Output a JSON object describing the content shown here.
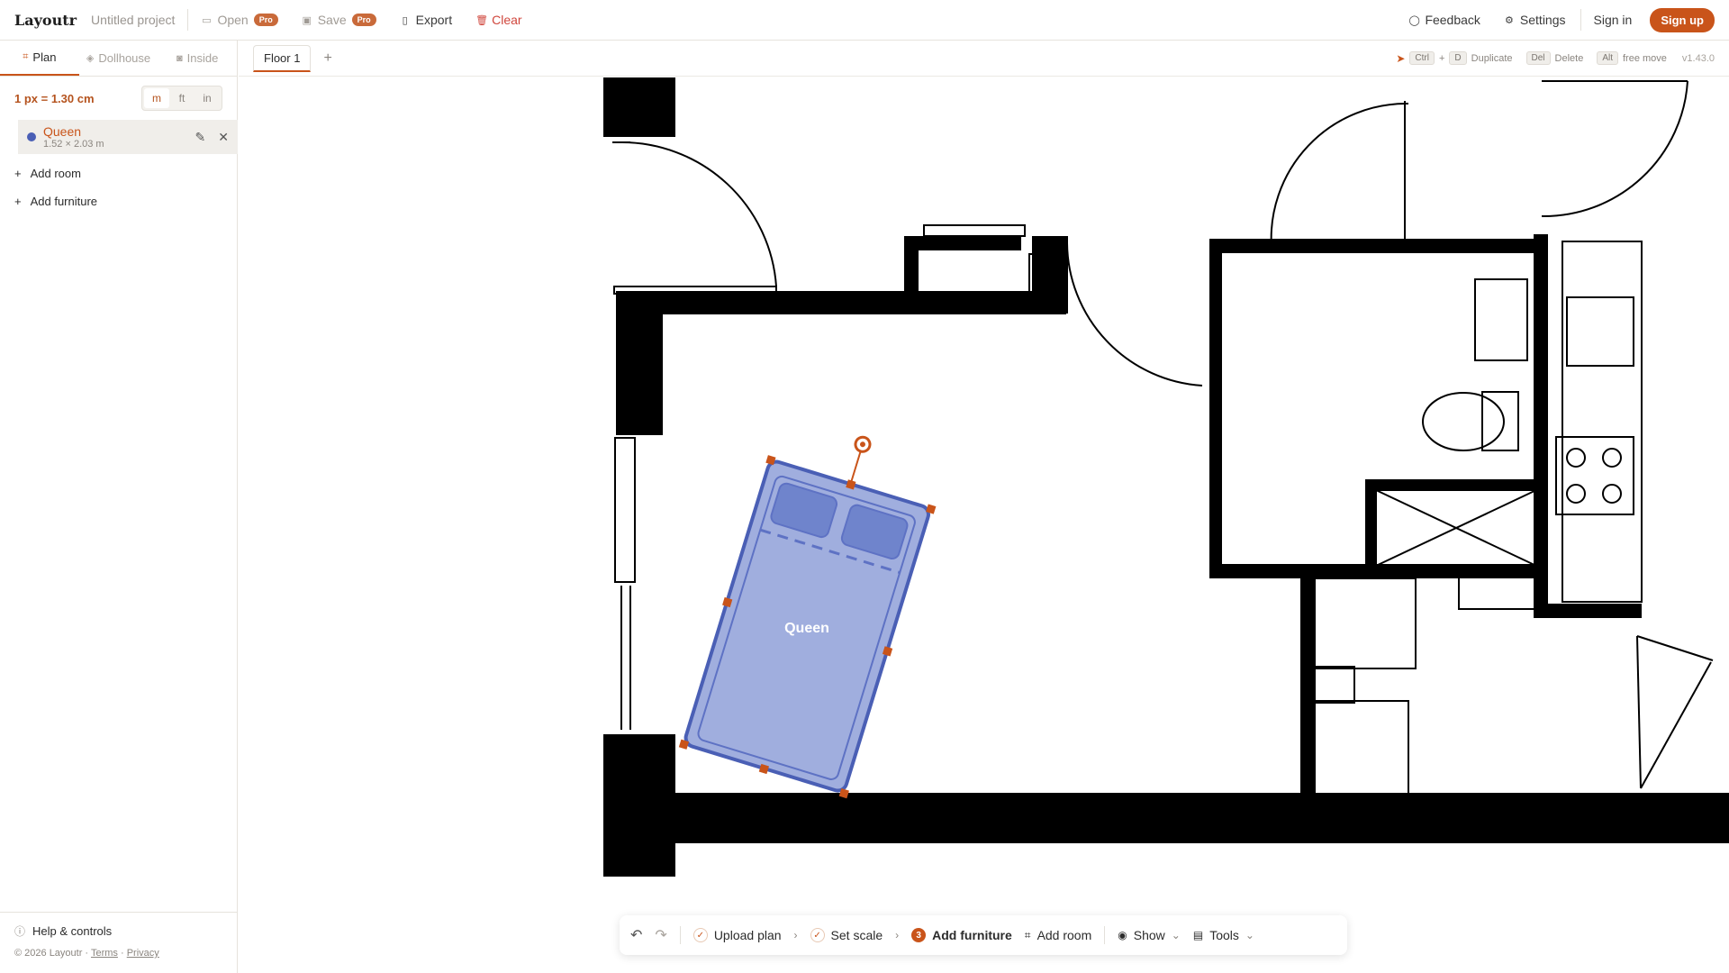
{
  "app": {
    "brand": "Layoutr",
    "project": "Untitled project"
  },
  "topbar": {
    "open": "Open",
    "save": "Save",
    "pro": "Pro",
    "export": "Export",
    "clear": "Clear",
    "feedback": "Feedback",
    "settings": "Settings",
    "signin": "Sign in",
    "signup": "Sign up"
  },
  "sidebar": {
    "tabs": [
      {
        "label": "Plan"
      },
      {
        "label": "Dollhouse"
      },
      {
        "label": "Inside"
      }
    ],
    "scale": "1 px = 1.30 cm",
    "units": [
      "m",
      "ft",
      "in"
    ],
    "items": [
      {
        "name": "Queen",
        "dims": "1.52 × 2.03 m"
      }
    ],
    "add_room": "Add room",
    "add_furniture": "Add furniture",
    "help": "Help & controls",
    "copyright": "© 2026 Layoutr ·",
    "terms": "Terms",
    "dot": "·",
    "privacy": "Privacy"
  },
  "floorbar": {
    "floor": "Floor 1",
    "hints": {
      "ctrl": "Ctrl",
      "plus": "+",
      "d": "D",
      "duplicate": "Duplicate",
      "del": "Del",
      "delete": "Delete",
      "alt": "Alt",
      "freemove": "free move",
      "version": "v1.43.0"
    }
  },
  "canvas": {
    "bed_label": "Queen"
  },
  "bottom": {
    "upload": "Upload plan",
    "scale": "Set scale",
    "step3": "3",
    "furniture": "Add furniture",
    "room": "Add room",
    "show": "Show",
    "tools": "Tools"
  },
  "colors": {
    "accent": "#c9541a",
    "bed_fill": "#8fa0d8",
    "bed_stroke": "#4a5fb5",
    "wall": "#000000"
  }
}
